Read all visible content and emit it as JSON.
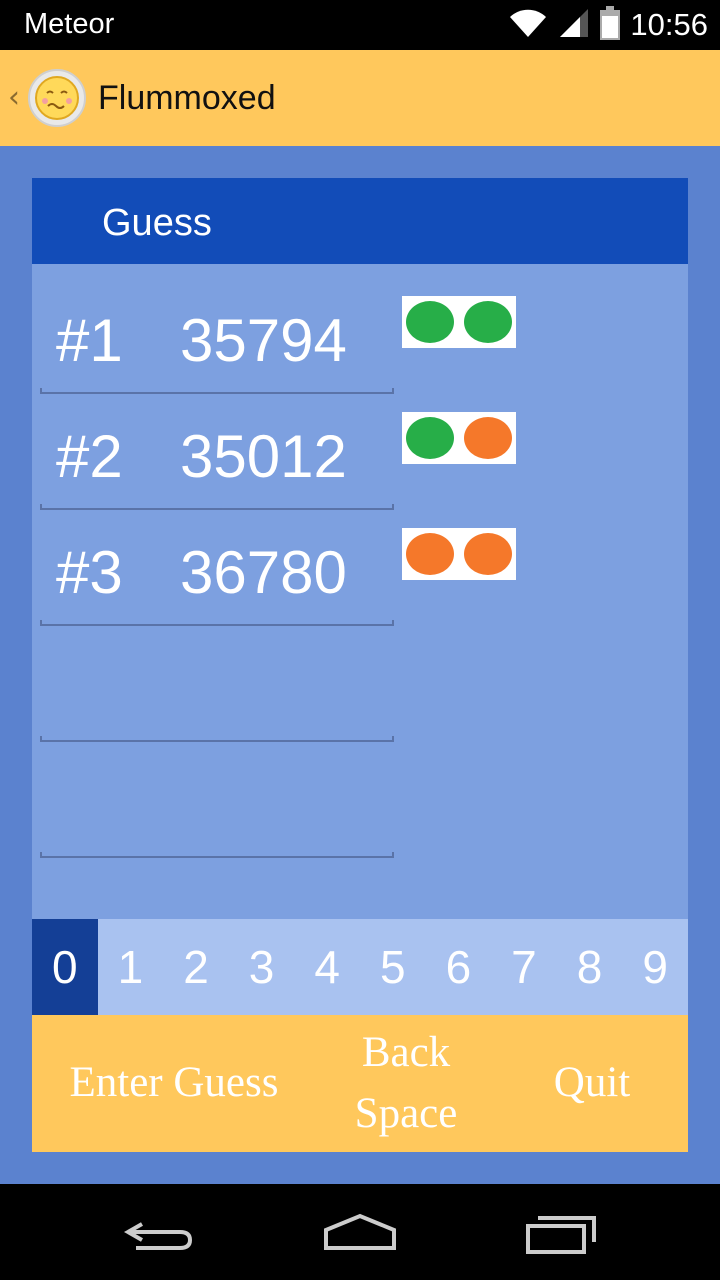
{
  "status_bar": {
    "carrier": "Meteor",
    "time": "10:56",
    "icons": [
      "wifi-icon",
      "signal-icon",
      "battery-icon"
    ]
  },
  "action_bar": {
    "title": "Flummoxed",
    "icon": "confused-face-icon"
  },
  "panel": {
    "header": "Guess"
  },
  "guesses": [
    {
      "label": "#1",
      "code": "35794",
      "pegs": [
        "green",
        "green"
      ]
    },
    {
      "label": "#2",
      "code": "35012",
      "pegs": [
        "green",
        "orange"
      ]
    },
    {
      "label": "#3",
      "code": "36780",
      "pegs": [
        "orange",
        "orange"
      ]
    },
    {
      "label": "",
      "code": "",
      "pegs": []
    },
    {
      "label": "",
      "code": "",
      "pegs": []
    }
  ],
  "digits": [
    "0",
    "1",
    "2",
    "3",
    "4",
    "5",
    "6",
    "7",
    "8",
    "9"
  ],
  "selected_digit": "0",
  "buttons": {
    "enter_guess": "Enter Guess",
    "back_space_line1": "Back",
    "back_space_line2": "Space",
    "quit": "Quit"
  },
  "colors": {
    "peg_green": "#27ae48",
    "peg_orange": "#f5782a",
    "accent_yellow": "#ffc85c",
    "header_blue": "#124cb8",
    "selected_digit_bg": "#143f96"
  },
  "nav_bar": {
    "icons": [
      "back-icon",
      "home-icon",
      "recents-icon"
    ]
  }
}
